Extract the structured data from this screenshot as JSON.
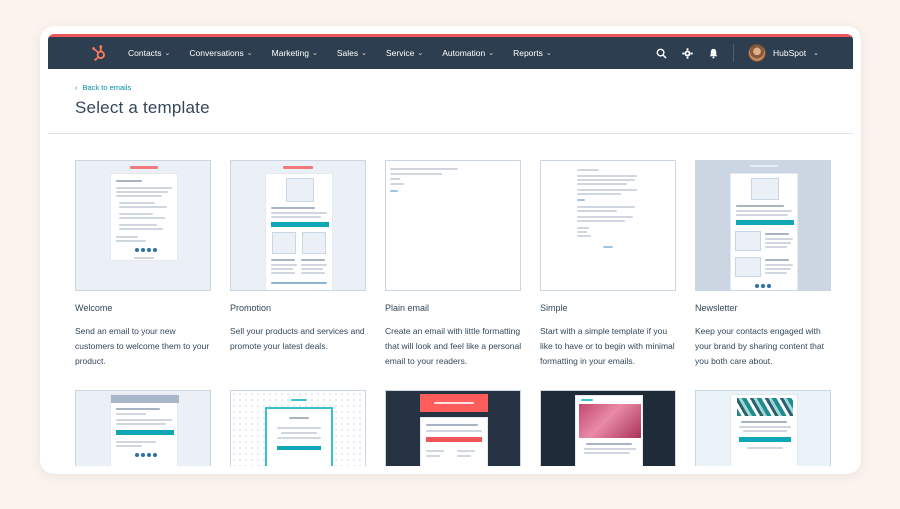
{
  "nav": {
    "items": [
      {
        "label": "Contacts"
      },
      {
        "label": "Conversations"
      },
      {
        "label": "Marketing"
      },
      {
        "label": "Sales"
      },
      {
        "label": "Service"
      },
      {
        "label": "Automation"
      },
      {
        "label": "Reports"
      }
    ],
    "account_name": "HubSpot",
    "chevron": "⌄"
  },
  "header": {
    "back_label": "Back to emails",
    "back_arrow": "‹",
    "title": "Select a template"
  },
  "templates": [
    {
      "name": "Welcome",
      "description": "Send an email to your new customers to welcome them to your product."
    },
    {
      "name": "Promotion",
      "description": "Sell your products and services and promote your latest deals."
    },
    {
      "name": "Plain email",
      "description": "Create an email with little formatting that will look and feel like a personal email to your readers."
    },
    {
      "name": "Simple",
      "description": "Start with a simple template if you like to have or to begin with minimal formatting in your emails."
    },
    {
      "name": "Newsletter",
      "description": "Keep your contacts engaged with your brand by sharing content that you both care about."
    }
  ],
  "colors": {
    "navbar": "#2d3e50",
    "accent": "#f2545b",
    "link": "#0091ae",
    "teal": "#0fa7b5",
    "logo": "#ff7a59",
    "background": "#fbf3ee"
  },
  "icons": [
    "hubspot-logo-icon",
    "search-icon",
    "gear-icon",
    "bell-icon",
    "chevron-down-icon"
  ]
}
